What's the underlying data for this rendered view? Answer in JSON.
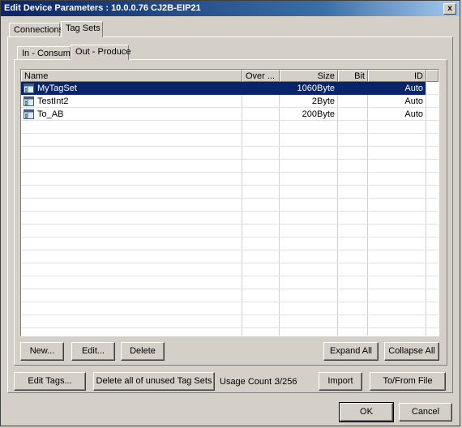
{
  "window": {
    "title": "Edit Device Parameters : 10.0.0.76 CJ2B-EIP21",
    "close_label": "x"
  },
  "tabs": [
    {
      "label": "Connections",
      "active": false
    },
    {
      "label": "Tag Sets",
      "active": true
    }
  ],
  "subtabs": [
    {
      "label": "In - Consume",
      "active": false
    },
    {
      "label": "Out - Produce",
      "active": true
    }
  ],
  "table": {
    "columns": [
      "Name",
      "Over ...",
      "Size",
      "Bit",
      "ID"
    ],
    "rows": [
      {
        "name": "MyTagSet",
        "over": "",
        "size": "1060Byte",
        "bit": "",
        "id": "Auto",
        "selected": true,
        "icon": "tagset-icon"
      },
      {
        "name": "TestInt2",
        "over": "",
        "size": "2Byte",
        "bit": "",
        "id": "Auto",
        "selected": false,
        "icon": "tagset-icon"
      },
      {
        "name": "To_AB",
        "over": "",
        "size": "200Byte",
        "bit": "",
        "id": "Auto",
        "selected": false,
        "icon": "tagset-icon"
      }
    ]
  },
  "list_buttons": {
    "new": "New...",
    "edit": "Edit...",
    "delete": "Delete",
    "expand_all": "Expand All",
    "collapse_all": "Collapse All"
  },
  "bottom": {
    "edit_tags": "Edit Tags...",
    "delete_unused": "Delete all of unused Tag Sets",
    "usage_label": "Usage Count :",
    "usage_value": "3/256",
    "import": "Import",
    "to_from_file": "To/From File"
  },
  "dialog_buttons": {
    "ok": "OK",
    "cancel": "Cancel"
  },
  "colors": {
    "selection": "#0a246a",
    "face": "#d4d0c8",
    "title_start": "#0a246a"
  }
}
